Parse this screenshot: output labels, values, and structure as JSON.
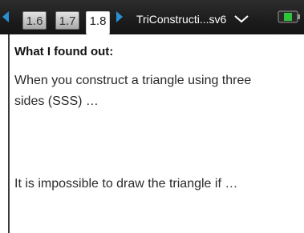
{
  "tabs": [
    {
      "label": "1.6",
      "active": false
    },
    {
      "label": "1.7",
      "active": false
    },
    {
      "label": "1.8",
      "active": true
    }
  ],
  "document": {
    "title": "TriConstructi...sv6"
  },
  "icons": {
    "prev": "left-arrow-icon",
    "next": "right-arrow-icon",
    "menu": "chevron-down-icon",
    "battery": "battery-icon"
  },
  "colors": {
    "accent": "#2b8fd4",
    "battery_green": "#2fc43a"
  },
  "notes": {
    "heading": "What I found out:",
    "paragraph1_line1": "When you construct a triangle using three",
    "paragraph1_line2": "sides (SSS) …",
    "paragraph2": "It is impossible to draw the triangle if …"
  }
}
